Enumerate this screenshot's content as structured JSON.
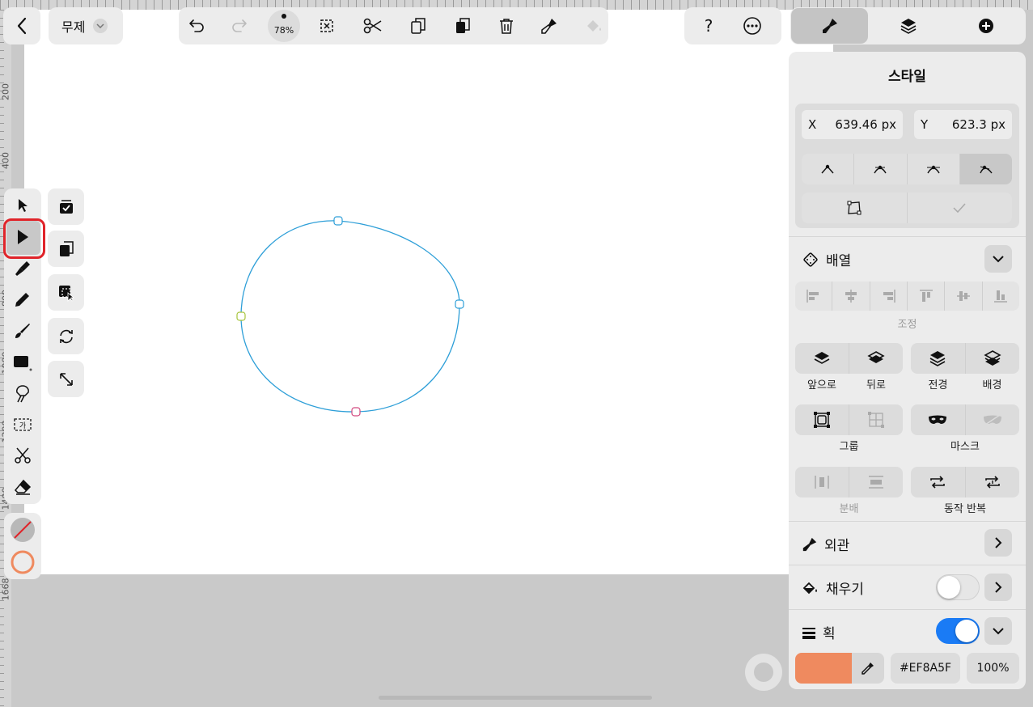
{
  "document": {
    "name": "무제",
    "zoom": "78%"
  },
  "ruler": {
    "left_labels": [
      "200",
      "400",
      "800",
      "1000",
      "1200",
      "1400",
      "1668"
    ]
  },
  "panel": {
    "title": "스타일",
    "x_label": "X",
    "x_value": "639.46 px",
    "y_label": "Y",
    "y_value": "623.3 px",
    "arrange": {
      "title": "배열",
      "adjust_label": "조정",
      "front": "앞으로",
      "back": "뒤로",
      "to_front": "전경",
      "to_back": "배경",
      "group": "그룹",
      "mask": "마스크",
      "distribute": "분배",
      "repeat": "동작 반복"
    },
    "appearance": {
      "title": "외관"
    },
    "fill": {
      "title": "채우기",
      "enabled": false
    },
    "stroke": {
      "title": "획",
      "enabled": true,
      "color": "#EF8A5F",
      "hex_label": "#EF8A5F",
      "opacity": "100%"
    }
  },
  "colors": {
    "stroke": "#EF8A5F",
    "path": "#2e9fd8",
    "accent_blue": "#1a7bf5",
    "selection_red": "#e0242a"
  }
}
